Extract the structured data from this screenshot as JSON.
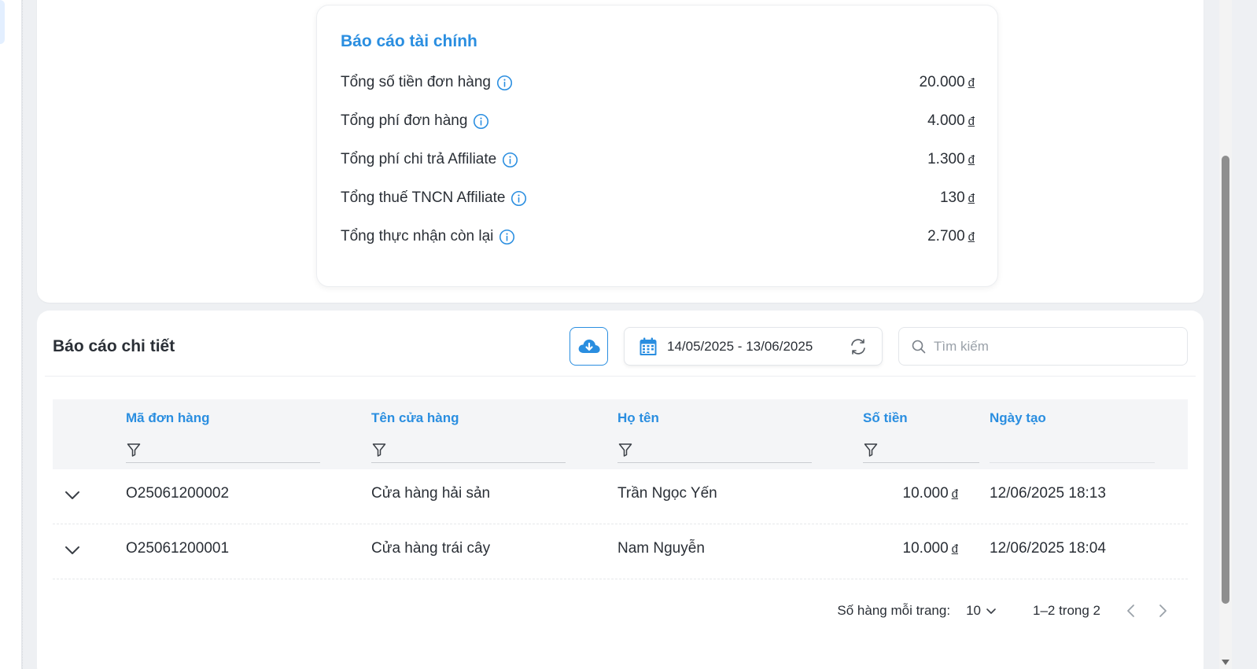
{
  "financial_report": {
    "title": "Báo cáo tài chính",
    "rows": [
      {
        "label": "Tổng số tiền đơn hàng",
        "value": "20.000",
        "currency": "đ"
      },
      {
        "label": "Tổng phí đơn hàng",
        "value": "4.000",
        "currency": "đ"
      },
      {
        "label": "Tổng phí chi trả Affiliate",
        "value": "1.300",
        "currency": "đ"
      },
      {
        "label": "Tổng thuế TNCN Affiliate",
        "value": "130",
        "currency": "đ"
      },
      {
        "label": "Tổng thực nhận còn lại",
        "value": "2.700",
        "currency": "đ"
      }
    ]
  },
  "detail_report": {
    "title": "Báo cáo chi tiết",
    "date_range": "14/05/2025 - 13/06/2025",
    "search_placeholder": "Tìm kiếm",
    "columns": {
      "order_id": "Mã đơn hàng",
      "store_name": "Tên cửa hàng",
      "full_name": "Họ tên",
      "amount": "Số tiền",
      "created_at": "Ngày tạo"
    },
    "rows": [
      {
        "order_id": "O25061200002",
        "store_name": "Cửa hàng hải sản",
        "full_name": "Trần Ngọc Yến",
        "amount": "10.000",
        "currency": "đ",
        "created_at": "12/06/2025 18:13"
      },
      {
        "order_id": "O25061200001",
        "store_name": "Cửa hàng trái cây",
        "full_name": "Nam Nguyễn",
        "amount": "10.000",
        "currency": "đ",
        "created_at": "12/06/2025 18:04"
      }
    ],
    "pagination": {
      "rows_per_page_label": "Số hàng mỗi trang:",
      "rows_per_page": "10",
      "range": "1–2 trong 2"
    }
  },
  "colors": {
    "accent": "#2a8ee0",
    "text": "#2a2f36",
    "header_bg": "#f4f5f7"
  }
}
